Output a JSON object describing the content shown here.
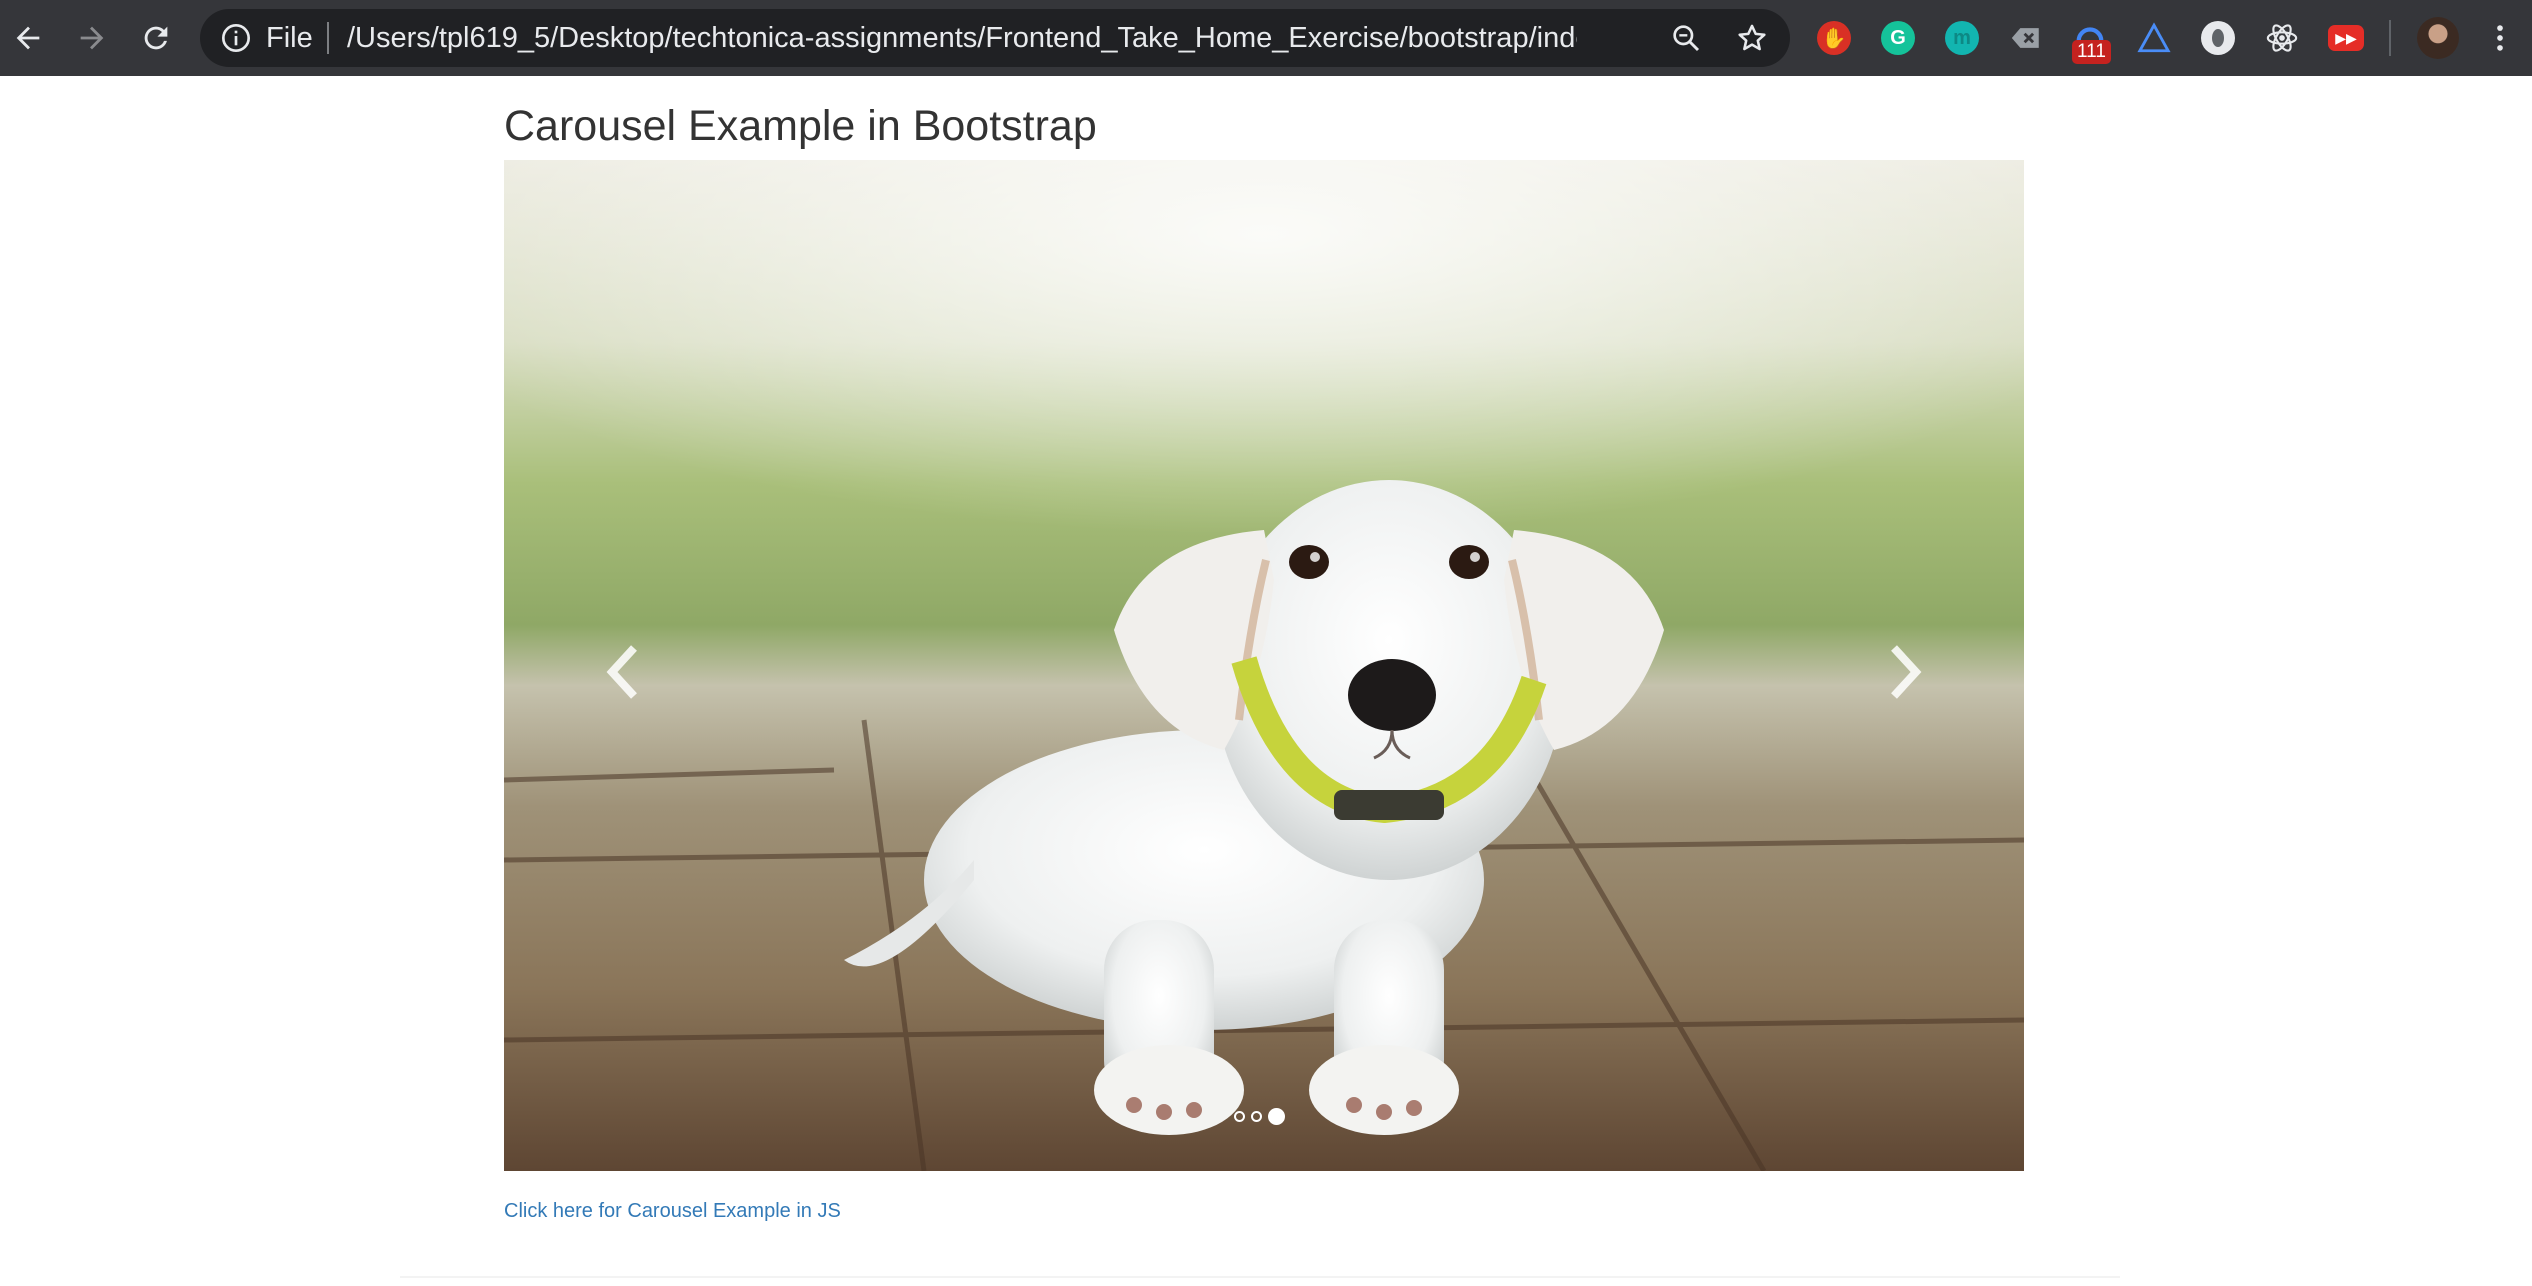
{
  "browser": {
    "file_label": "File",
    "url": "/Users/tpl619_5/Desktop/techtonica-assignments/Frontend_Take_Home_Exercise/bootstrap/inde...",
    "extension_badge": "111",
    "icons": [
      "back-icon",
      "forward-icon",
      "reload-icon",
      "info-icon",
      "zoom-icon",
      "star-icon",
      "hand-extension-icon",
      "grammarly-extension-icon",
      "extension-icon",
      "clear-extension-icon",
      "counter-extension-icon",
      "triangle-extension-icon",
      "circle-extension-icon",
      "react-devtools-icon",
      "video-extension-icon",
      "avatar",
      "menu-icon"
    ]
  },
  "page": {
    "title": "Carousel Example in Bootstrap",
    "link_text": "Click here for Carousel Example in JS"
  },
  "carousel": {
    "slide_count": 3,
    "active_index": 2,
    "image_subject": "white puppy on wooden deck"
  },
  "colors": {
    "toolbar_bg": "#35363a",
    "omnibox_bg": "#202124",
    "link": "#337ab7",
    "title": "#333333"
  }
}
